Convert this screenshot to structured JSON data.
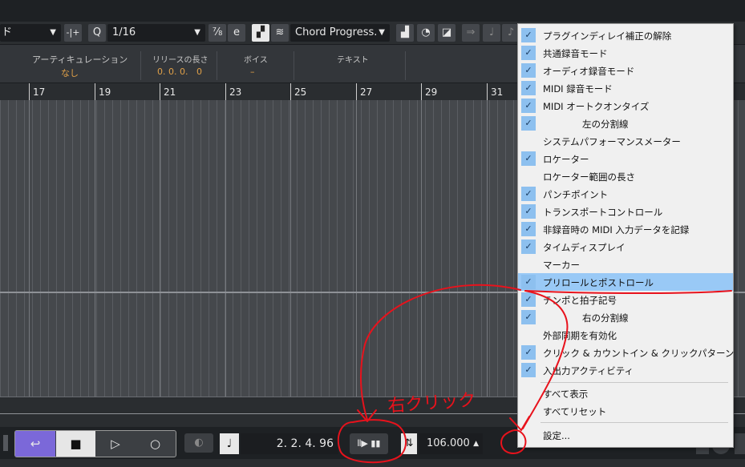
{
  "toolbar": {
    "mode_fragment": "ド",
    "quantize_label": "Q",
    "quantize_value": "1/16",
    "chord_track": "Chord Progress."
  },
  "info_line": {
    "articulation_header": "アーティキュレーション",
    "articulation_value": "なし",
    "release_header": "リリースの長さ",
    "release_value": "0. 0. 0.   0",
    "voice_header": "ボイス",
    "voice_value": "–",
    "text_header": "テキスト"
  },
  "ruler": {
    "bars": [
      "17",
      "19",
      "21",
      "23",
      "25",
      "27",
      "29",
      "31"
    ]
  },
  "transport": {
    "position": "2. 2. 4. 96",
    "tempo": "106.000"
  },
  "context_menu": {
    "items": [
      {
        "label": "プラグインディレイ補正の解除",
        "checked": true
      },
      {
        "label": "共通録音モード",
        "checked": true
      },
      {
        "label": "オーディオ録音モード",
        "checked": true
      },
      {
        "label": "MIDI 録音モード",
        "checked": true
      },
      {
        "label": "MIDI オートクオンタイズ",
        "checked": true
      },
      {
        "label": "左の分割線",
        "checked": true
      },
      {
        "label": "システムパフォーマンスメーター",
        "checked": false
      },
      {
        "label": "ロケーター",
        "checked": true
      },
      {
        "label": "ロケーター範囲の長さ",
        "checked": false
      },
      {
        "label": "パンチポイント",
        "checked": true
      },
      {
        "label": "トランスポートコントロール",
        "checked": true
      },
      {
        "label": "非録音時の MIDI 入力データを記録",
        "checked": true
      },
      {
        "label": "タイムディスプレイ",
        "checked": true
      },
      {
        "label": "マーカー",
        "checked": false
      },
      {
        "label": "プリロールとポストロール",
        "checked": true
      },
      {
        "label": "テンポと拍子記号",
        "checked": true
      },
      {
        "label": "右の分割線",
        "checked": true
      },
      {
        "label": "外部同期を有効化",
        "checked": false
      },
      {
        "label": "クリック & カウントイン & クリックパターン",
        "checked": true
      },
      {
        "label": "入出力アクティビティ",
        "checked": true
      }
    ],
    "show_all": "すべて表示",
    "reset_all": "すべてリセット",
    "settings": "設定..."
  },
  "annotation": {
    "text": "右クリック"
  },
  "colors": {
    "accent_purple": "#7b68d9",
    "menu_check": "#8dc0ef",
    "annotation_red": "#e8121c"
  }
}
